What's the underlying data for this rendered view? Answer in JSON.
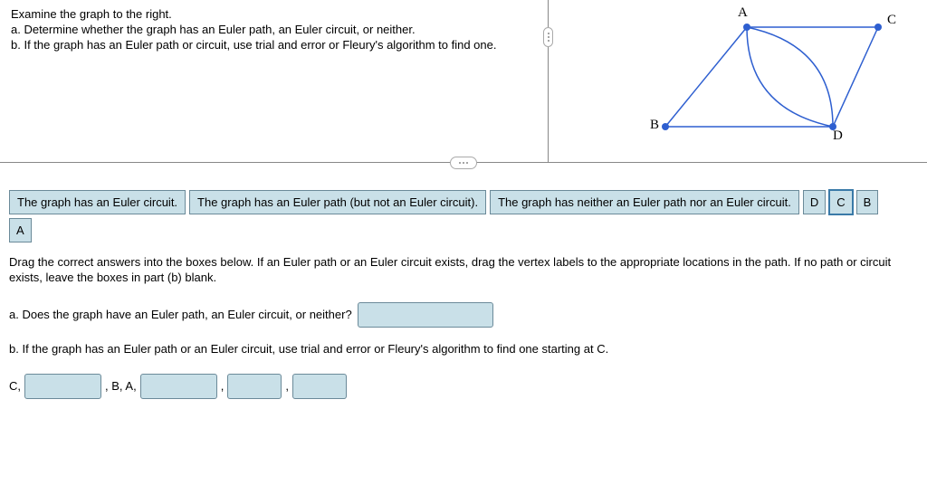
{
  "problem": {
    "intro": "Examine the graph to the right.",
    "a": "a. Determine whether the graph has an Euler path, an Euler circuit, or neither.",
    "b": "b. If the graph has an Euler path or circuit, use trial and error or Fleury's algorithm to find one."
  },
  "graph": {
    "vertices": {
      "A": "A",
      "B": "B",
      "C": "C",
      "D": "D"
    }
  },
  "bank": {
    "opt1": "The graph has an Euler circuit.",
    "opt2": "The graph has an Euler path (but not an Euler circuit).",
    "opt3": "The graph has neither an Euler path nor an Euler circuit.",
    "vD": "D",
    "vC": "C",
    "vB": "B",
    "vA": "A"
  },
  "instructions": "Drag the correct answers into the boxes below. If an Euler path or an Euler circuit exists, drag the vertex labels to the appropriate locations in the path. If no path or circuit exists, leave the boxes in part (b) blank.",
  "qa": {
    "text": "a. Does the graph have an Euler path, an Euler circuit, or neither?"
  },
  "qb": {
    "text": "b. If the graph has an Euler path or an Euler circuit, use trial and error or Fleury's algorithm to find one starting at C.",
    "prefix": "C,",
    "mid1": ", B, A,",
    "comma": ","
  }
}
